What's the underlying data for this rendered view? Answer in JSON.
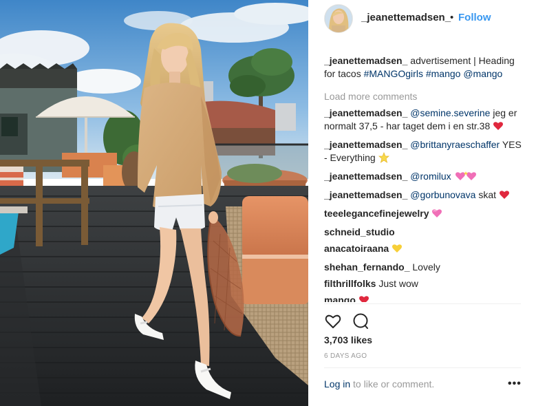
{
  "header": {
    "username": "_jeanettemadsen_",
    "separator": "•",
    "follow_label": "Follow"
  },
  "caption": {
    "username": "_jeanettemadsen_",
    "text": " advertisement | Heading for tacos ",
    "tags": [
      "#MANGOgirls",
      "#mango",
      "@mango"
    ]
  },
  "load_more": "Load more comments",
  "comments": [
    {
      "user": "_jeanettemadsen_",
      "mention": "@semine.severine",
      "text": " jeg er normalt 37,5 - har taget dem i en str.38 ",
      "emoji": "heart"
    },
    {
      "user": "_jeanettemadsen_",
      "mention": "@brittanyraeschaffer",
      "text": " YES - Everything ",
      "emoji": "star"
    },
    {
      "user": "_jeanettemadsen_",
      "mention": "@romilux",
      "text": " ",
      "emoji": "sparkle-hearts"
    },
    {
      "user": "_jeanettemadsen_",
      "mention": "@gorbunovava",
      "text": " skat ",
      "emoji": "heart"
    },
    {
      "user": "teeelegancefinejewelry",
      "mention": "",
      "text": " ",
      "emoji": "pink-heart"
    },
    {
      "user": "schneid_studio",
      "mention": "",
      "text": "",
      "emoji": ""
    },
    {
      "user": "anacatoiraana",
      "mention": "",
      "text": " ",
      "emoji": "yellow-heart"
    },
    {
      "user": "shehan_fernando_",
      "mention": "",
      "text": " Lovely",
      "emoji": ""
    },
    {
      "user": "filthrillfolks",
      "mention": "",
      "text": " Just wow",
      "emoji": ""
    },
    {
      "user": "mango",
      "mention": "",
      "text": " ",
      "emoji": "heart"
    }
  ],
  "actions": {
    "like_icon": "heart-outline-icon",
    "comment_icon": "comment-bubble-icon"
  },
  "likes": "3,703 likes",
  "date": "6 DAYS AGO",
  "footer": {
    "login_link": "Log in",
    "login_rest": " to like or comment.",
    "more": "•••"
  },
  "colors": {
    "link": "#003569",
    "follow": "#3897f0",
    "muted": "#999999",
    "text": "#262626",
    "heart": "#ed4956"
  }
}
